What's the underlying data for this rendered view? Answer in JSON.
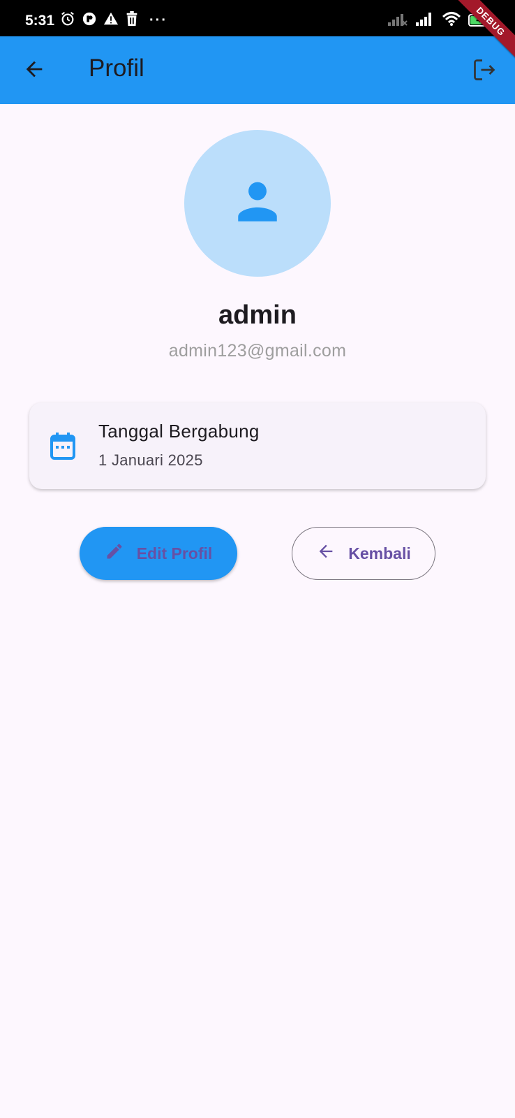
{
  "status_bar": {
    "time": "5:31",
    "battery_percent": 49,
    "battery_label": "49",
    "icons_left": [
      "alarm-icon",
      "app-notification-icon",
      "warning-icon",
      "trash-icon"
    ],
    "more_label": "···",
    "icons_right": [
      "signal-off-icon",
      "signal-icon",
      "wifi-icon",
      "battery-icon"
    ]
  },
  "debug_banner": "DEBUG",
  "app_bar": {
    "title": "Profil",
    "background": "#2196f3",
    "back_icon": "arrow-back-icon",
    "logout_icon": "logout-icon"
  },
  "profile": {
    "avatar_icon": "person-icon",
    "username": "admin",
    "email": "admin123@gmail.com"
  },
  "join_card": {
    "icon": "calendar-icon",
    "title": "Tanggal Bergabung",
    "value": "1 Januari 2025"
  },
  "actions": {
    "edit_label": "Edit Profil",
    "edit_icon": "pencil-icon",
    "back_label": "Kembali",
    "back_icon": "arrow-back-icon"
  },
  "colors": {
    "primary": "#2196f3",
    "avatar_bg": "#bbdefb",
    "accent_text": "#6750a4",
    "page_bg": "#fdf7fe"
  }
}
